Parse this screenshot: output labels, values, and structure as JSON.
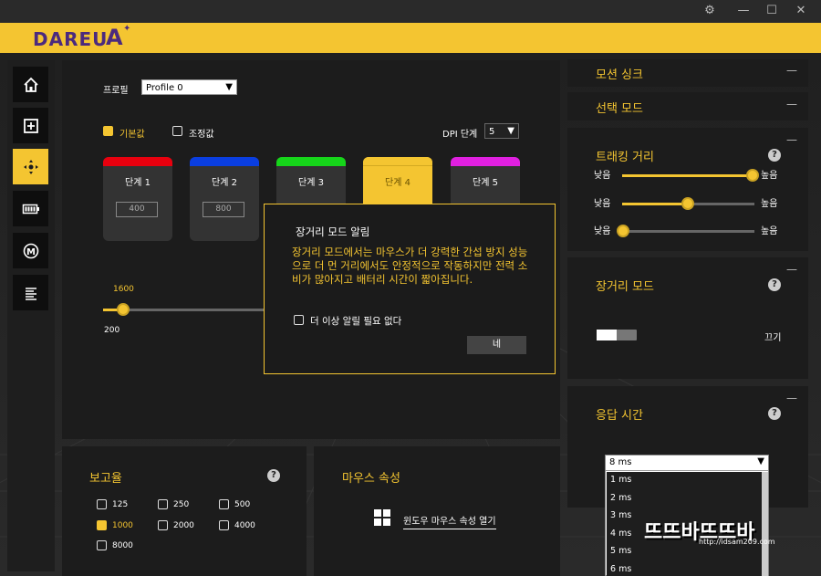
{
  "titlebar": {
    "settings_icon": "gear-icon",
    "minimize": "—",
    "maximize": "☐",
    "close": "✕"
  },
  "brand": {
    "logo": "DAREU",
    "logo_mark": "A"
  },
  "sidebar": {
    "items": [
      {
        "icon": "home-icon"
      },
      {
        "icon": "plus-square-icon"
      },
      {
        "icon": "crosshair-icon",
        "active": true
      },
      {
        "icon": "battery-icon"
      },
      {
        "icon": "macro-icon",
        "glyph": "M"
      },
      {
        "icon": "list-icon"
      }
    ]
  },
  "profile": {
    "label": "프로필",
    "value": "Profile 0"
  },
  "modes": {
    "default_label": "기본값",
    "custom_label": "조정값"
  },
  "dpi_stage": {
    "label": "DPI 단계",
    "value": "5"
  },
  "dpi_cards": [
    {
      "name": "단계   1",
      "value": "400",
      "color": "#e8000e"
    },
    {
      "name": "단계   2",
      "value": "800",
      "color": "#0a3ee0"
    },
    {
      "name": "단계   3",
      "value": "",
      "color": "#16d51a"
    },
    {
      "name": "단계   4",
      "value": "",
      "color": "#f4c531"
    },
    {
      "name": "단계   5",
      "value": "",
      "color": "#e020e0"
    }
  ],
  "dpi_slider": {
    "value_label": "1600",
    "min_label": "200",
    "level": 0.09
  },
  "dialog": {
    "title": "장거리 모드 알림",
    "message": "장거리 모드에서는 마우스가 더 강력한 간섭 방지 성능으로 더 먼 거리에서도 안정적으로 작동하지만 전력 소비가 많아지고 배터리 시간이 짧아집니다.",
    "checkbox_label": "더 이상 알릴 필요 없다",
    "ok_label": "네"
  },
  "polling": {
    "title": "보고율",
    "rates": [
      "125",
      "250",
      "500",
      "1000",
      "2000",
      "4000",
      "8000"
    ],
    "selected": "1000"
  },
  "mouse_props": {
    "title": "마우스 속성",
    "link": "윈도우 마우스 속성 열기"
  },
  "right": {
    "motion_sync": "모션 싱크",
    "select_mode": "선택 모드",
    "tracking": {
      "title": "트래킹 거리",
      "low": "낮음",
      "high": "높음",
      "levels": [
        0.98,
        0.5,
        0.0
      ]
    },
    "long_range": {
      "title": "장거리 모드",
      "state": "끄기"
    },
    "response": {
      "title": "응답 시간",
      "selected": "8 ms",
      "options": [
        "1 ms",
        "2 ms",
        "3 ms",
        "4 ms",
        "5 ms",
        "6 ms"
      ]
    },
    "minus": "—"
  },
  "watermark": {
    "text": "뜨뜨바뜨뜨바",
    "url": "http://idsam209.com"
  },
  "colors": {
    "accent": "#f4c531",
    "panel": "#1c1c1c",
    "logo": "#4b2a7e"
  }
}
